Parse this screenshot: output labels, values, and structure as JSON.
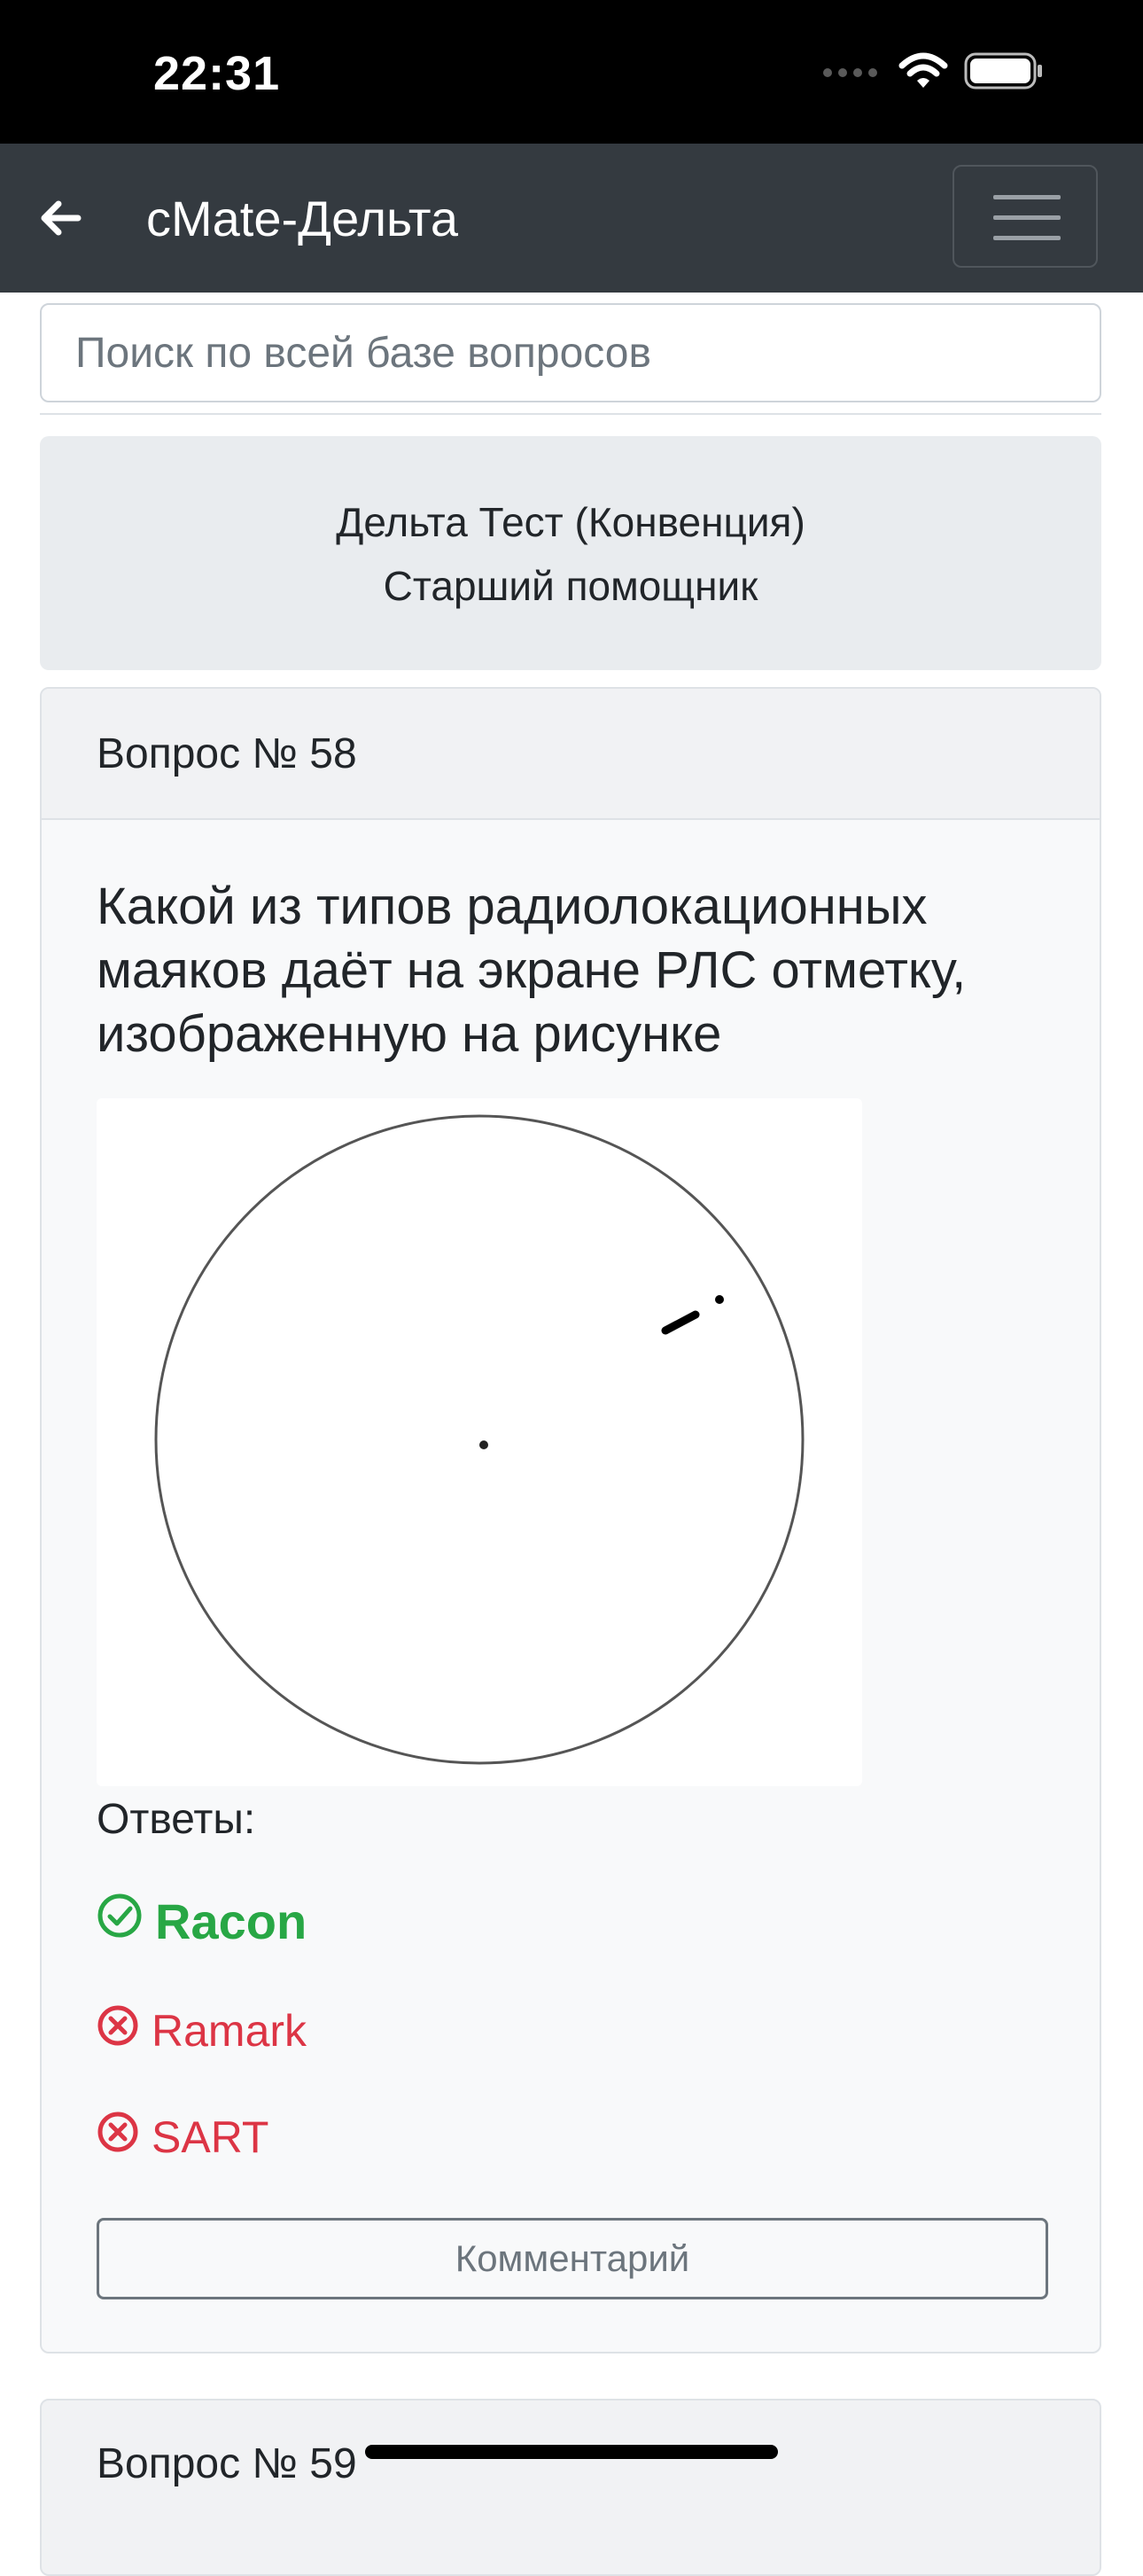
{
  "status_bar": {
    "time": "22:31"
  },
  "navbar": {
    "title": "cMate-Дельта"
  },
  "search": {
    "placeholder": "Поиск по всей базе вопросов"
  },
  "test_info": {
    "line1": "Дельта Тест (Конвенция)",
    "line2": "Старший помощник"
  },
  "question_card": {
    "header": "Вопрос № 58",
    "question_text": "Какой из типов радиолокационных маяков даёт на экране РЛС отметку, изображенную на рисунке",
    "answers_label": "Ответы:",
    "answers": [
      {
        "text": "Racon",
        "status": "correct"
      },
      {
        "text": "Ramark",
        "status": "wrong"
      },
      {
        "text": "SART",
        "status": "wrong"
      }
    ],
    "comment_button": "Комментарий"
  },
  "next_card": {
    "header": "Вопрос № 59"
  },
  "colors": {
    "navbar": "#343a40",
    "correct": "#28a745",
    "wrong": "#dc3545",
    "muted": "#6c757d"
  }
}
